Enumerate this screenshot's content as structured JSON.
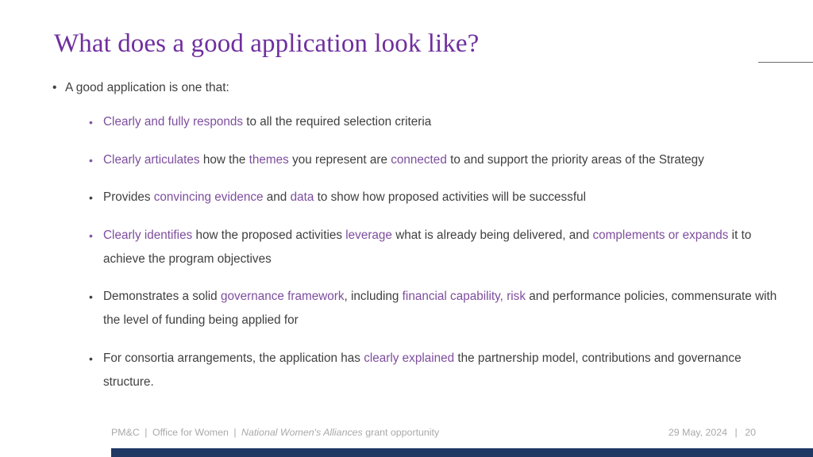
{
  "slide": {
    "title": "What does a good application look like?",
    "colors": {
      "title_purple": "#6f2f9f",
      "highlight_purple": "#7e4e9e",
      "body_grey": "#3f3f3f",
      "footer_grey": "#a9a9a9",
      "bottom_bar_navy": "#1f3864",
      "top_rule_grey": "#6b6b6b"
    },
    "bullet_glyph": "•",
    "intro_bullet": "A good application is one that:",
    "sub_bullets": [
      {
        "marker_color": "purple",
        "segments": [
          {
            "text": "Clearly and fully responds",
            "highlight": true
          },
          {
            "text": " to all the required selection criteria",
            "highlight": false
          }
        ]
      },
      {
        "marker_color": "purple",
        "segments": [
          {
            "text": "Clearly articulates",
            "highlight": true
          },
          {
            "text": " how the ",
            "highlight": false
          },
          {
            "text": "themes",
            "highlight": true
          },
          {
            "text": " you represent are ",
            "highlight": false
          },
          {
            "text": "connected",
            "highlight": true
          },
          {
            "text": " to and support the priority areas of the Strategy",
            "highlight": false
          }
        ]
      },
      {
        "marker_color": "grey",
        "segments": [
          {
            "text": "Provides ",
            "highlight": false
          },
          {
            "text": "convincing evidence",
            "highlight": true
          },
          {
            "text": " and ",
            "highlight": false
          },
          {
            "text": "data",
            "highlight": true
          },
          {
            "text": " to show how proposed activities will be successful",
            "highlight": false
          }
        ]
      },
      {
        "marker_color": "purple",
        "segments": [
          {
            "text": "Clearly identifies",
            "highlight": true
          },
          {
            "text": " how the proposed activities ",
            "highlight": false
          },
          {
            "text": "leverage",
            "highlight": true
          },
          {
            "text": " what is already being delivered, and ",
            "highlight": false
          },
          {
            "text": "complements or expands",
            "highlight": true
          },
          {
            "text": " it to achieve the program objectives",
            "highlight": false
          }
        ]
      },
      {
        "marker_color": "grey",
        "segments": [
          {
            "text": "Demonstrates a solid ",
            "highlight": false
          },
          {
            "text": "governance framework",
            "highlight": true
          },
          {
            "text": ", including ",
            "highlight": false
          },
          {
            "text": "financial capability,",
            "highlight": true
          },
          {
            "text": " ",
            "highlight": false
          },
          {
            "text": "risk",
            "highlight": true
          },
          {
            "text": " and performance policies, commensurate with the level of funding being applied for",
            "highlight": false
          }
        ]
      },
      {
        "marker_color": "grey",
        "segments": [
          {
            "text": "For consortia arrangements, the application has ",
            "highlight": false
          },
          {
            "text": "clearly explained",
            "highlight": true
          },
          {
            "text": " the partnership model, contributions and governance structure.",
            "highlight": false
          }
        ]
      }
    ]
  },
  "footer": {
    "organisation": "PM&C",
    "division": "Office for Women",
    "program_italic": "National Women's Alliances",
    "program_tail": " grant opportunity",
    "separator": "|",
    "date": "29 May, 2024",
    "page_number": "20"
  }
}
